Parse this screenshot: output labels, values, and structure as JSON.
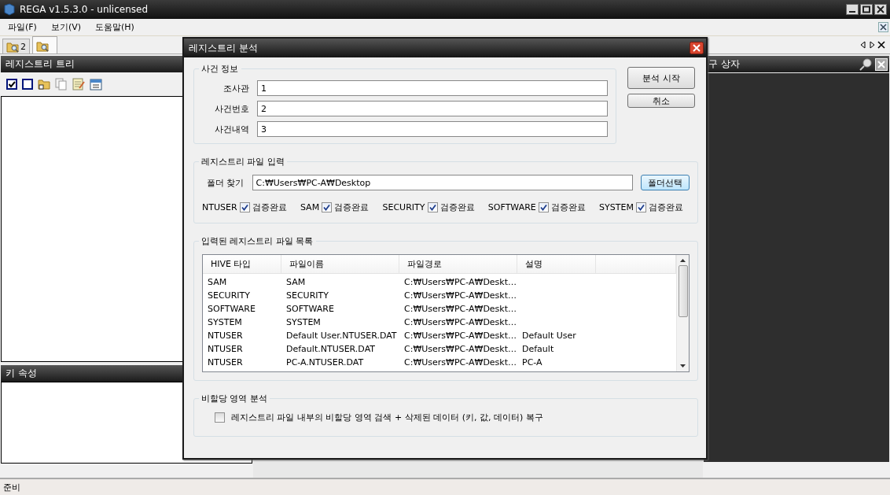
{
  "window": {
    "title": "REGA v1.5.3.0 - unlicensed"
  },
  "menu": [
    {
      "label": "파일(F)"
    },
    {
      "label": "보기(V)"
    },
    {
      "label": "도움말(H)"
    }
  ],
  "doc_tabs": [
    {
      "label": "2",
      "selected": false
    },
    {
      "selected": true
    }
  ],
  "left_panel": {
    "title": "레지스트리 트리"
  },
  "properties_panel": {
    "title": "키 속성"
  },
  "right_panel": {
    "title": "구 상자"
  },
  "dialog": {
    "title": "레지스트리 분석",
    "case_info": {
      "legend": "사건 정보",
      "fields": [
        {
          "label": "조사관",
          "value": "1"
        },
        {
          "label": "사건번호",
          "value": "2"
        },
        {
          "label": "사건내역",
          "value": "3"
        }
      ]
    },
    "buttons": [
      "분석 시작",
      "취소"
    ],
    "file_input": {
      "legend": "레지스트리 파일 입력",
      "folder_label": "폴더 찾기",
      "folder_value": "C:₩Users₩PC-A₩Desktop",
      "browse_button": "폴더선택",
      "hives": [
        {
          "name": "NTUSER",
          "checked": true,
          "status": "검증완료"
        },
        {
          "name": "SAM",
          "checked": true,
          "status": "검증완료"
        },
        {
          "name": "SECURITY",
          "checked": true,
          "status": "검증완료"
        },
        {
          "name": "SOFTWARE",
          "checked": true,
          "status": "검증완료"
        },
        {
          "name": "SYSTEM",
          "checked": true,
          "status": "검증완료"
        }
      ]
    },
    "file_list": {
      "legend": "입력된 레지스트리 파일 목록",
      "columns": [
        "HIVE 타입",
        "파일이름",
        "파일경로",
        "설명"
      ],
      "rows": [
        [
          "SAM",
          "SAM",
          "C:₩Users₩PC-A₩Deskt…"
        ],
        [
          "SECURITY",
          "SECURITY",
          "C:₩Users₩PC-A₩Deskt…"
        ],
        [
          "SOFTWARE",
          "SOFTWARE",
          "C:₩Users₩PC-A₩Deskt…"
        ],
        [
          "SYSTEM",
          "SYSTEM",
          "C:₩Users₩PC-A₩Deskt…"
        ],
        [
          "NTUSER",
          "Default User.NTUSER.DAT",
          "C:₩Users₩PC-A₩Deskt…",
          "Default User"
        ],
        [
          "NTUSER",
          "Default.NTUSER.DAT",
          "C:₩Users₩PC-A₩Deskt…",
          "Default"
        ],
        [
          "NTUSER",
          "PC-A.NTUSER.DAT",
          "C:₩Users₩PC-A₩Deskt…",
          "PC-A"
        ]
      ]
    },
    "unallocated": {
      "legend": "비할당 영역 분석",
      "option": {
        "label": "레지스트리 파일 내부의 비할당 영역 검색 + 삭제된 데이터 (키, 값, 데이터) 복구",
        "checked": false
      }
    }
  },
  "status_bar": "준비"
}
